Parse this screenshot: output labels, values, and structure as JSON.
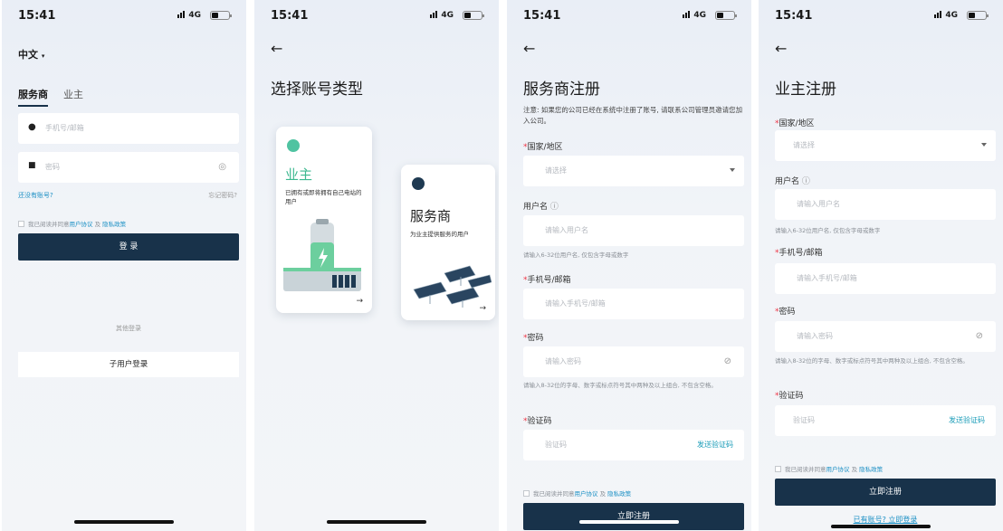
{
  "status_bar": {
    "time": "15:41",
    "signal": "4G"
  },
  "login": {
    "language": "中文",
    "tabs": [
      "服务商",
      "业主"
    ],
    "phone_placeholder": "手机号/邮箱",
    "password_placeholder": "密码",
    "no_account": "还没有账号?",
    "forgot": "忘记密码?",
    "agree_prefix": "我已阅读并同意",
    "user_agreement": "用户协议",
    "and": "及",
    "privacy": "隐私政策",
    "login_button": "登 录",
    "other_login": "其他登录",
    "sub_user_login": "子用户登录"
  },
  "account_type": {
    "title": "选择账号类型",
    "owner": {
      "title": "业主",
      "desc": "已拥有或即将拥有自己电站的用户",
      "arrow": "→"
    },
    "provider": {
      "title": "服务商",
      "desc": "为业主提供服务的用户",
      "arrow": "→"
    }
  },
  "provider_register": {
    "title": "服务商注册",
    "notice": "注意: 如果您的公司已经在系统中注册了账号, 请联系公司管理员邀请您加入公司。",
    "country_label": "国家/地区",
    "select_placeholder": "请选择",
    "username_label": "用户名",
    "username_placeholder": "请输入用户名",
    "username_hint": "请输入6-32位用户名, 仅包含字母或数字",
    "phone_label": "手机号/邮箱",
    "phone_placeholder": "请输入手机号/邮箱",
    "password_label": "密码",
    "password_placeholder": "请输入密码",
    "password_hint": "请输入8-32位的字母、数字或标点符号其中两种及以上组合, 不包含空格。",
    "code_label": "验证码",
    "code_placeholder": "验证码",
    "send_code": "发送验证码",
    "agree_prefix": "我已阅读并同意",
    "user_agreement": "用户协议",
    "and": "及",
    "privacy": "隐私政策",
    "register_button": "立即注册"
  },
  "owner_register": {
    "title": "业主注册",
    "country_label": "国家/地区",
    "select_placeholder": "请选择",
    "username_label": "用户名",
    "username_placeholder": "请输入用户名",
    "username_hint": "请输入6-32位用户名, 仅包含字母或数字",
    "phone_label": "手机号/邮箱",
    "phone_placeholder": "请输入手机号/邮箱",
    "password_label": "密码",
    "password_placeholder": "请输入密码",
    "password_hint": "请输入8-32位的字母、数字或标点符号其中两种及以上组合, 不包含空格。",
    "code_label": "验证码",
    "code_placeholder": "验证码",
    "send_code": "发送验证码",
    "agree_prefix": "我已阅读并同意",
    "user_agreement": "用户协议",
    "and": "及",
    "privacy": "隐私政策",
    "register_button": "立即注册",
    "have_account": "已有账号? 立即登录"
  },
  "colors": {
    "primary": "#18324a",
    "link": "#1a8fc4",
    "accent_green": "#4fc3a1"
  }
}
